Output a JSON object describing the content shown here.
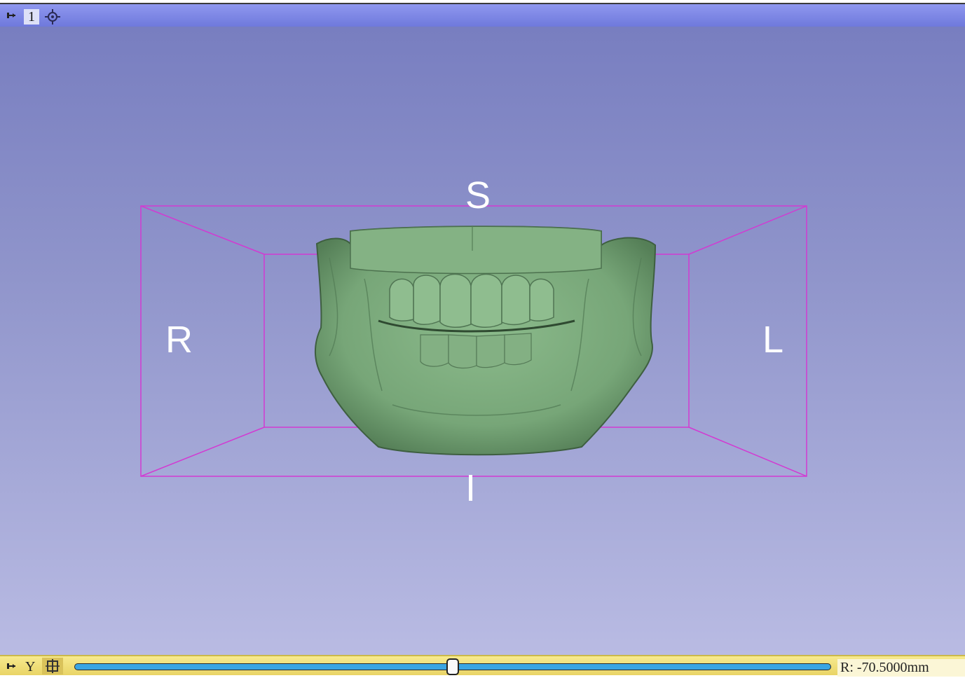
{
  "view_controller": {
    "view_number": "1",
    "pin_icon": "pin-icon",
    "center_icon": "crosshair-icon"
  },
  "orientation_labels": {
    "superior": "S",
    "inferior": "I",
    "right": "R",
    "left": "L"
  },
  "scene": {
    "model": "mandible-dentition-surface",
    "model_color": "#7aa77a",
    "bounding_box_color": "#d23ad2"
  },
  "slice_controller": {
    "pin_icon": "pin-icon",
    "axis_label": "Y",
    "layout_icon": "slice-options-icon",
    "slider_level": 0.5,
    "offset_value": "R: -70.5000mm",
    "accent_color": "#3aa5e3"
  }
}
